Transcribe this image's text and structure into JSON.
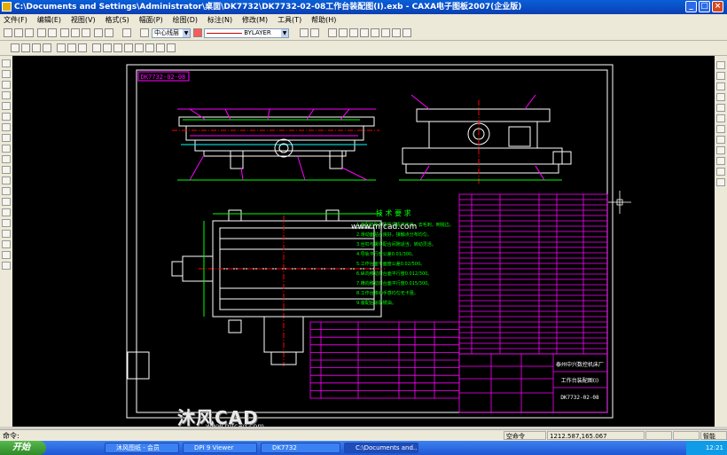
{
  "window": {
    "title": "C:\\Documents and Settings\\Administrator\\桌面\\DK7732\\DK7732-02-08工作台装配图(I).exb - CAXA电子图板2007(企业版)",
    "min": "_",
    "max": "□",
    "close": "×"
  },
  "menu": [
    "文件(F)",
    "编辑(E)",
    "视图(V)",
    "格式(S)",
    "幅面(P)",
    "绘图(D)",
    "标注(N)",
    "修改(M)",
    "工具(T)",
    "帮助(H)"
  ],
  "toolbar": {
    "layer_combo": "中心线层",
    "linetype_combo": "BYLAYER"
  },
  "drawing": {
    "code_box": "DK7732-02-08",
    "tech_title": "技 术 要 求",
    "tech_lines": [
      "1.装配前所有零件须清洗干净，去毛刺，倒锐边。",
      "2.滑动面贴合良好，接触点分布均匀。",
      "3.丝杠与螺母配合间隙适当，转动灵活。",
      "4.导轨平行度公差0.01/300。",
      "5.工作台面平面度公差0.02/500。",
      "6.纵向移动对台面平行度0.012/300。",
      "7.横向移动对台面平行度0.015/300。",
      "8.工作台移动手感均匀无卡阻。",
      "9.装配后涂防锈油。"
    ],
    "company": "泰州中兴数控机床厂",
    "drawing_name": "工作台装配图(I)",
    "drawing_no": "DK7732-02-08",
    "site_watermark": "www.mfcad.com"
  },
  "watermark": {
    "brand": "沐风CAD",
    "url": "www.mfcad.com"
  },
  "status": {
    "command": "命令:",
    "mode": "空命令",
    "coords": "1212.587,165.067",
    "snap": "智能"
  },
  "taskbar": {
    "start": "开始",
    "tasks": [
      "沐风图纸 - 会员",
      "DPI 9 Viewer",
      "DK7732",
      "C:\\Documents and..."
    ],
    "clock": "12:21"
  },
  "colors": {
    "canvas": "#000000",
    "border": "#ffffff",
    "table": "#ff00ff",
    "part_lines": "#ff00ff",
    "geometry": "#ffffff",
    "tech_text": "#00ff00",
    "center_lines": "#ff0000",
    "dimension": "#00ff00"
  }
}
